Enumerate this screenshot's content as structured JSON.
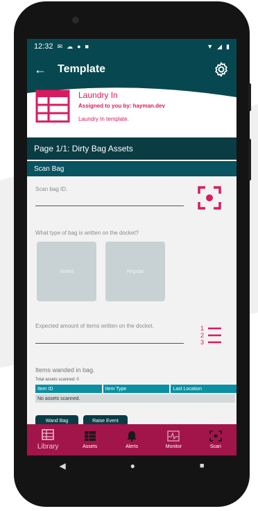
{
  "status_bar": {
    "time": "12:32"
  },
  "app_bar": {
    "title": "Template"
  },
  "template": {
    "name": "Laundry In",
    "assigned": "Assigned to you by: hayman.dev",
    "description": "Laundry In template."
  },
  "page": {
    "title": "Page 1/1: Dirty Bag Assets",
    "section_title": "Scan Bag"
  },
  "fields": {
    "scan_bag_placeholder": "Scan bag ID.",
    "bag_type_question": "What type of bag is written on the docket?",
    "bag_type_options": [
      "Soiled",
      "Regular"
    ],
    "expected_items_placeholder": "Expected amount of items written on the docket."
  },
  "wanded": {
    "title": "Items wanded in bag.",
    "total": "Total assets scanned: 0",
    "columns": [
      "Item ID",
      "Item Type",
      "Last Location"
    ],
    "empty_message": "No assets scanned."
  },
  "actions": {
    "wand_bag": "Wand Bag",
    "raise_event": "Raise Event"
  },
  "bottom_nav": [
    {
      "label": "Library",
      "icon": "library-icon",
      "active": true
    },
    {
      "label": "Assets",
      "icon": "assets-icon",
      "active": false
    },
    {
      "label": "Alerts",
      "icon": "bell-icon",
      "active": false
    },
    {
      "label": "Monitor",
      "icon": "monitor-icon",
      "active": false
    },
    {
      "label": "Scan",
      "icon": "scan-icon",
      "active": false
    }
  ],
  "colors": {
    "primary": "#07474f",
    "accent": "#d81b60",
    "nav": "#a2154a",
    "table_header": "#0b8fa3"
  }
}
